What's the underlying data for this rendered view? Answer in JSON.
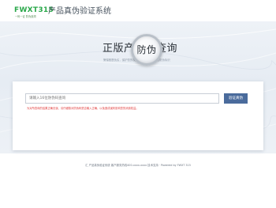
{
  "header": {
    "logo_text": "FWXT315",
    "logo_subtext": "一码一证 防伪追溯",
    "title": "产品真伪验证系统"
  },
  "banner": {
    "title_left": "正版产品",
    "title_right": "查询",
    "magnifier_text": "防伪",
    "subtitle": "警惕假冒伪劣，保护您的权益 · 请认准正版产品防伪标识"
  },
  "query": {
    "placeholder": "请输入16位防伪码查询",
    "button_label": "验证真伪",
    "hint": "为对所查询的结果正确无误，请仔细核对防伪码是否输入正确，以免造成误判影响您的消费权益。"
  },
  "footer": {
    "text": "汇 产品真伪验证系统 客户服务热线400-xxxx-xxxx 技术支持 · Powered by FWXT 315"
  },
  "colors": {
    "brand_green": "#2aa84a",
    "button_blue": "#4a6b9c",
    "hint_red": "#e03a3a"
  }
}
